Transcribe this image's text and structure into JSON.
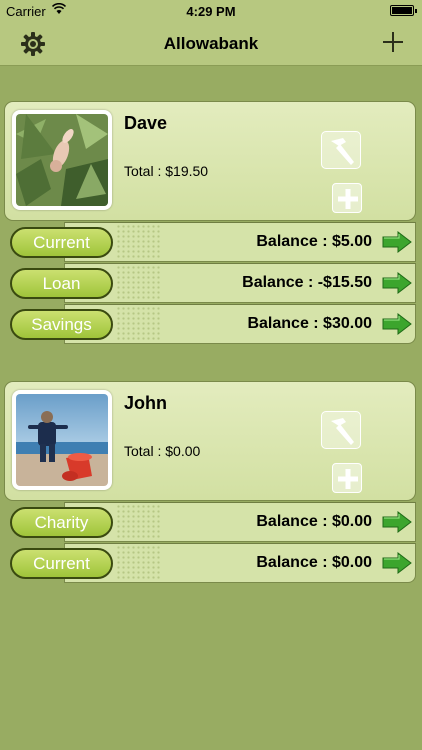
{
  "status_bar": {
    "carrier": "Carrier",
    "time": "4:29 PM"
  },
  "nav": {
    "title": "Allowabank",
    "left_icon": "gear-icon",
    "right_icon": "plus-icon"
  },
  "accent_colors": {
    "pill": "#b6d455",
    "arrow": "#3ca52d",
    "background": "#98ac62"
  },
  "children": [
    {
      "name": "Dave",
      "total": "Total : $19.50",
      "accounts": [
        {
          "label": "Current",
          "balance": "Balance : $5.00"
        },
        {
          "label": "Loan",
          "balance": "Balance : -$15.50"
        },
        {
          "label": "Savings",
          "balance": "Balance : $30.00"
        }
      ]
    },
    {
      "name": "John",
      "total": "Total : $0.00",
      "accounts": [
        {
          "label": "Charity",
          "balance": "Balance : $0.00"
        },
        {
          "label": "Current",
          "balance": "Balance : $0.00"
        }
      ]
    }
  ]
}
